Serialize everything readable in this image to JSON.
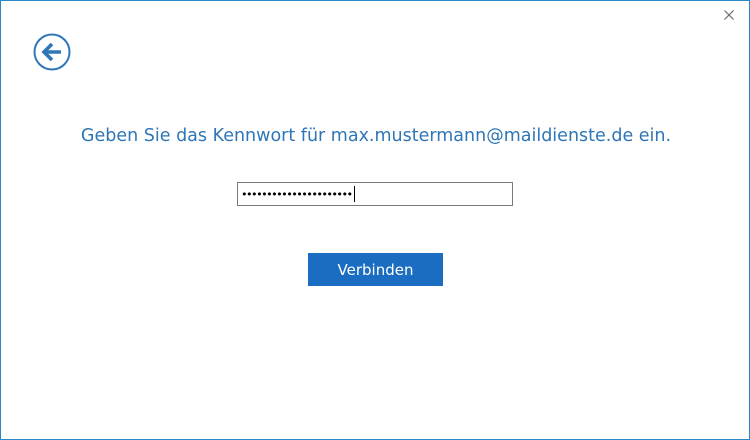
{
  "window": {
    "prompt": "Geben Sie das Kennwort für max.mustermann@maildienste.de ein.",
    "close_icon": "close-icon",
    "back_icon": "back-arrow-icon"
  },
  "password": {
    "masked_value": "••••••••••••••••••••••"
  },
  "actions": {
    "connect_label": "Verbinden"
  },
  "colors": {
    "accent": "#2e76b6",
    "button": "#1a6dc0",
    "border": "#2b88c8"
  }
}
